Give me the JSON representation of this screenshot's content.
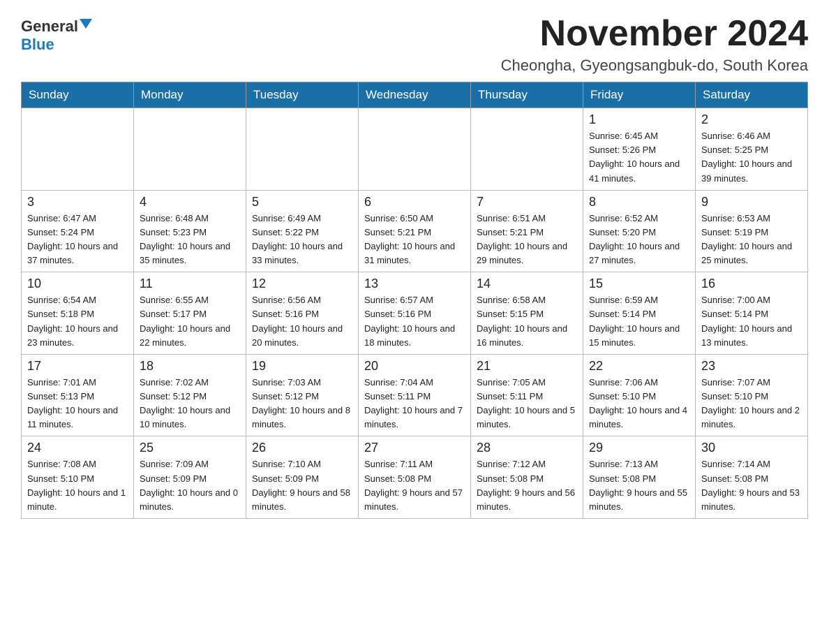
{
  "logo": {
    "general_text": "General",
    "blue_text": "Blue"
  },
  "title": "November 2024",
  "subtitle": "Cheongha, Gyeongsangbuk-do, South Korea",
  "headers": [
    "Sunday",
    "Monday",
    "Tuesday",
    "Wednesday",
    "Thursday",
    "Friday",
    "Saturday"
  ],
  "weeks": [
    [
      {
        "day": "",
        "info": ""
      },
      {
        "day": "",
        "info": ""
      },
      {
        "day": "",
        "info": ""
      },
      {
        "day": "",
        "info": ""
      },
      {
        "day": "",
        "info": ""
      },
      {
        "day": "1",
        "info": "Sunrise: 6:45 AM\nSunset: 5:26 PM\nDaylight: 10 hours and 41 minutes."
      },
      {
        "day": "2",
        "info": "Sunrise: 6:46 AM\nSunset: 5:25 PM\nDaylight: 10 hours and 39 minutes."
      }
    ],
    [
      {
        "day": "3",
        "info": "Sunrise: 6:47 AM\nSunset: 5:24 PM\nDaylight: 10 hours and 37 minutes."
      },
      {
        "day": "4",
        "info": "Sunrise: 6:48 AM\nSunset: 5:23 PM\nDaylight: 10 hours and 35 minutes."
      },
      {
        "day": "5",
        "info": "Sunrise: 6:49 AM\nSunset: 5:22 PM\nDaylight: 10 hours and 33 minutes."
      },
      {
        "day": "6",
        "info": "Sunrise: 6:50 AM\nSunset: 5:21 PM\nDaylight: 10 hours and 31 minutes."
      },
      {
        "day": "7",
        "info": "Sunrise: 6:51 AM\nSunset: 5:21 PM\nDaylight: 10 hours and 29 minutes."
      },
      {
        "day": "8",
        "info": "Sunrise: 6:52 AM\nSunset: 5:20 PM\nDaylight: 10 hours and 27 minutes."
      },
      {
        "day": "9",
        "info": "Sunrise: 6:53 AM\nSunset: 5:19 PM\nDaylight: 10 hours and 25 minutes."
      }
    ],
    [
      {
        "day": "10",
        "info": "Sunrise: 6:54 AM\nSunset: 5:18 PM\nDaylight: 10 hours and 23 minutes."
      },
      {
        "day": "11",
        "info": "Sunrise: 6:55 AM\nSunset: 5:17 PM\nDaylight: 10 hours and 22 minutes."
      },
      {
        "day": "12",
        "info": "Sunrise: 6:56 AM\nSunset: 5:16 PM\nDaylight: 10 hours and 20 minutes."
      },
      {
        "day": "13",
        "info": "Sunrise: 6:57 AM\nSunset: 5:16 PM\nDaylight: 10 hours and 18 minutes."
      },
      {
        "day": "14",
        "info": "Sunrise: 6:58 AM\nSunset: 5:15 PM\nDaylight: 10 hours and 16 minutes."
      },
      {
        "day": "15",
        "info": "Sunrise: 6:59 AM\nSunset: 5:14 PM\nDaylight: 10 hours and 15 minutes."
      },
      {
        "day": "16",
        "info": "Sunrise: 7:00 AM\nSunset: 5:14 PM\nDaylight: 10 hours and 13 minutes."
      }
    ],
    [
      {
        "day": "17",
        "info": "Sunrise: 7:01 AM\nSunset: 5:13 PM\nDaylight: 10 hours and 11 minutes."
      },
      {
        "day": "18",
        "info": "Sunrise: 7:02 AM\nSunset: 5:12 PM\nDaylight: 10 hours and 10 minutes."
      },
      {
        "day": "19",
        "info": "Sunrise: 7:03 AM\nSunset: 5:12 PM\nDaylight: 10 hours and 8 minutes."
      },
      {
        "day": "20",
        "info": "Sunrise: 7:04 AM\nSunset: 5:11 PM\nDaylight: 10 hours and 7 minutes."
      },
      {
        "day": "21",
        "info": "Sunrise: 7:05 AM\nSunset: 5:11 PM\nDaylight: 10 hours and 5 minutes."
      },
      {
        "day": "22",
        "info": "Sunrise: 7:06 AM\nSunset: 5:10 PM\nDaylight: 10 hours and 4 minutes."
      },
      {
        "day": "23",
        "info": "Sunrise: 7:07 AM\nSunset: 5:10 PM\nDaylight: 10 hours and 2 minutes."
      }
    ],
    [
      {
        "day": "24",
        "info": "Sunrise: 7:08 AM\nSunset: 5:10 PM\nDaylight: 10 hours and 1 minute."
      },
      {
        "day": "25",
        "info": "Sunrise: 7:09 AM\nSunset: 5:09 PM\nDaylight: 10 hours and 0 minutes."
      },
      {
        "day": "26",
        "info": "Sunrise: 7:10 AM\nSunset: 5:09 PM\nDaylight: 9 hours and 58 minutes."
      },
      {
        "day": "27",
        "info": "Sunrise: 7:11 AM\nSunset: 5:08 PM\nDaylight: 9 hours and 57 minutes."
      },
      {
        "day": "28",
        "info": "Sunrise: 7:12 AM\nSunset: 5:08 PM\nDaylight: 9 hours and 56 minutes."
      },
      {
        "day": "29",
        "info": "Sunrise: 7:13 AM\nSunset: 5:08 PM\nDaylight: 9 hours and 55 minutes."
      },
      {
        "day": "30",
        "info": "Sunrise: 7:14 AM\nSunset: 5:08 PM\nDaylight: 9 hours and 53 minutes."
      }
    ]
  ]
}
